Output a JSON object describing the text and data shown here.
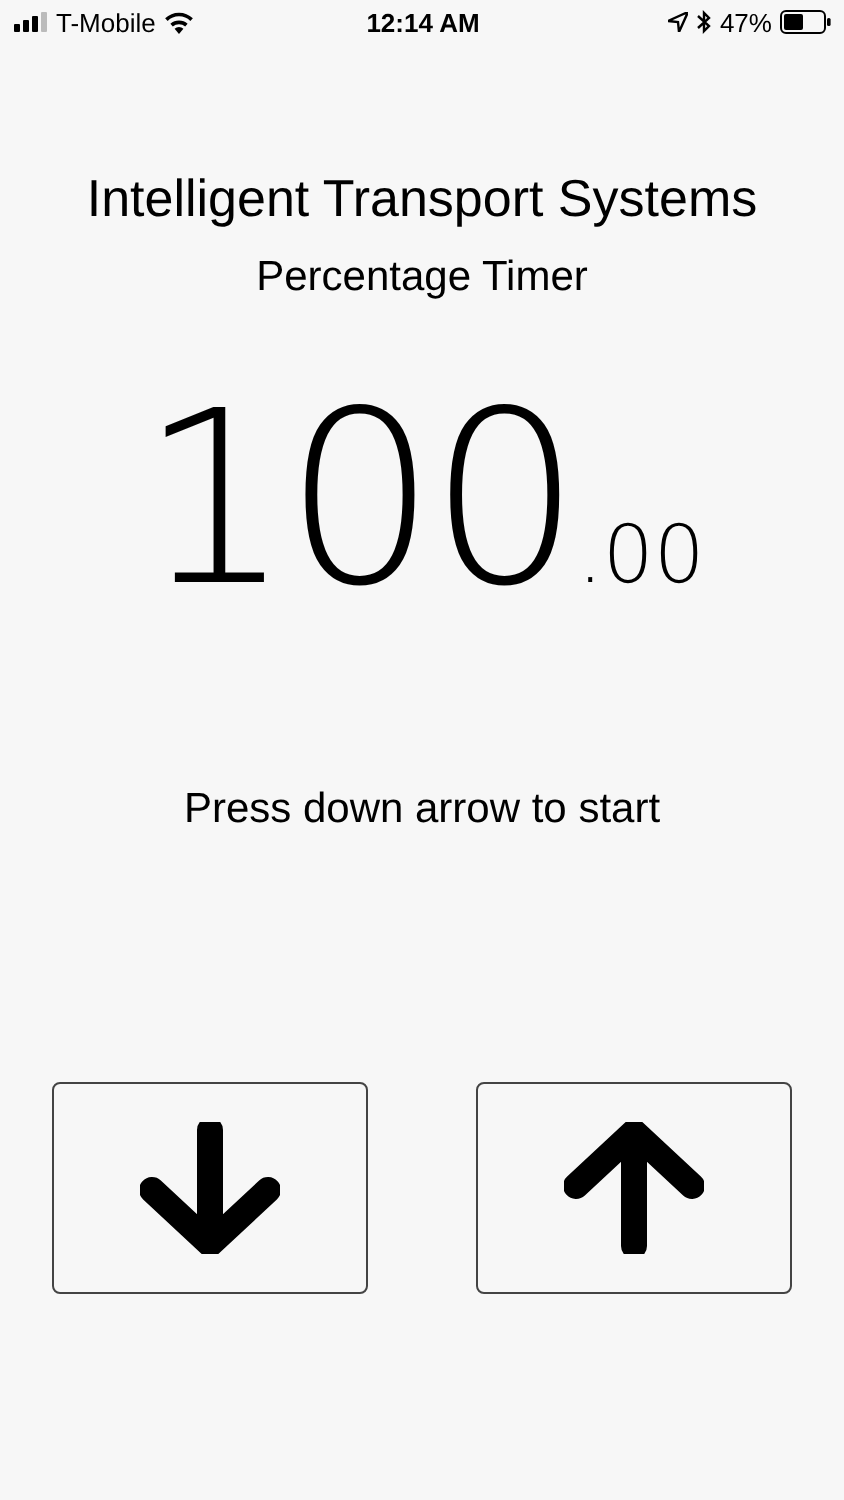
{
  "status_bar": {
    "carrier": "T-Mobile",
    "time": "12:14 AM",
    "battery": "47%"
  },
  "title": "Intelligent Transport Systems",
  "subtitle": "Percentage Timer",
  "timer": {
    "whole": "100",
    "fraction": ".00"
  },
  "instruction": "Press down arrow to start",
  "buttons": [
    {
      "kind": "down"
    },
    {
      "kind": "up"
    }
  ]
}
